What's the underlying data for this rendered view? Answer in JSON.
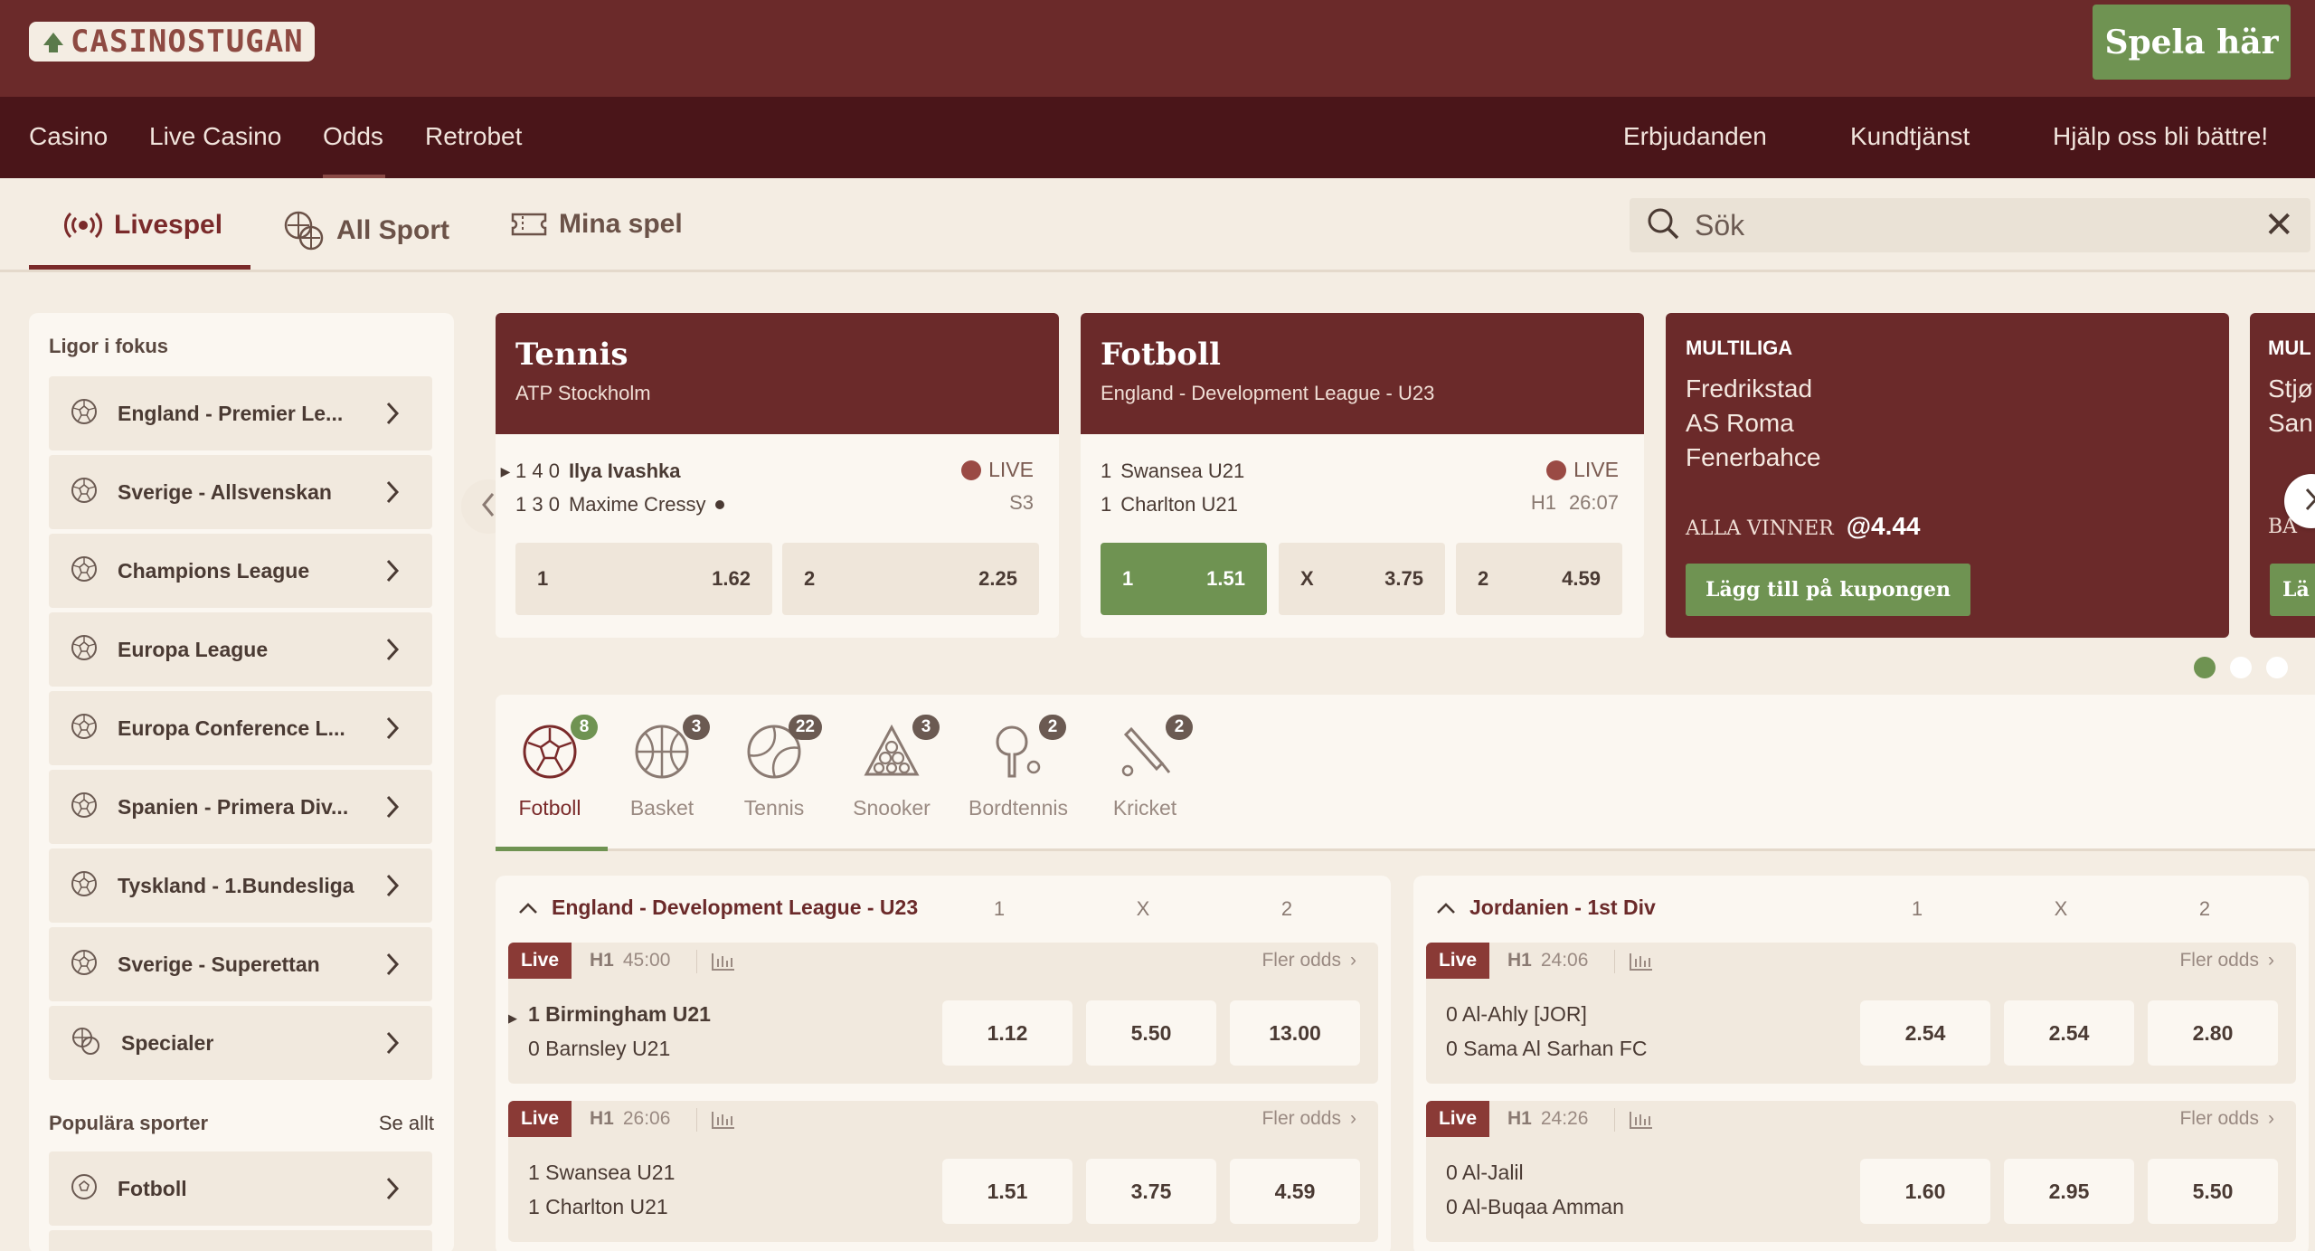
{
  "brand": {
    "name": "CASINOSTUGAN",
    "cta": "Spela här"
  },
  "nav": {
    "left": [
      "Casino",
      "Live Casino",
      "Odds",
      "Retrobet"
    ],
    "right": [
      "Erbjudanden",
      "Kundtjänst",
      "Hjälp oss bli bättre!"
    ],
    "active": "Odds"
  },
  "tabs": [
    {
      "label": "Livespel",
      "icon": "live-broadcast-icon",
      "active": true
    },
    {
      "label": "All Sport",
      "icon": "sports-balls-icon"
    },
    {
      "label": "Mina spel",
      "icon": "ticket-icon"
    }
  ],
  "search": {
    "placeholder": "Sök"
  },
  "sidebar": {
    "focus_title": "Ligor i fokus",
    "leagues": [
      "England - Premier Le...",
      "Sverige - Allsvenskan",
      "Champions League",
      "Europa League",
      "Europa Conference L...",
      "Spanien - Primera Div...",
      "Tyskland - 1.Bundesliga",
      "Sverige - Superettan",
      "Specialer"
    ],
    "popular_title": "Populära sporter",
    "see_all": "Se allt",
    "popular": [
      "Fotboll"
    ]
  },
  "cards": [
    {
      "sport": "Tennis",
      "league": "ATP Stockholm",
      "p1": {
        "score": "1 4 0",
        "name": "Ilya Ivashka"
      },
      "p2": {
        "score": "1 3 0",
        "name": "Maxime Cressy"
      },
      "status": "LIVE",
      "meta": "S3",
      "odds": [
        {
          "label": "1",
          "value": "1.62"
        },
        {
          "label": "2",
          "value": "2.25"
        }
      ]
    },
    {
      "sport": "Fotboll",
      "league": "England - Development League - U23",
      "p1": {
        "score": "1",
        "name": "Swansea U21"
      },
      "p2": {
        "score": "1",
        "name": "Charlton U21"
      },
      "status": "LIVE",
      "meta_period": "H1",
      "meta_time": "26:07",
      "odds": [
        {
          "label": "1",
          "value": "1.51",
          "selected": true
        },
        {
          "label": "X",
          "value": "3.75"
        },
        {
          "label": "2",
          "value": "4.59"
        }
      ]
    }
  ],
  "multi": {
    "title": "MULTILIGA",
    "teams": [
      "Fredrikstad",
      "AS Roma",
      "Fenerbahce"
    ],
    "win_label": "ALLA VINNER",
    "odds": "@4.44",
    "button": "Lägg till på kupongen",
    "next_title": "MUL",
    "next_teams": [
      "Stjø",
      "San"
    ],
    "next_win": "BA",
    "next_btn": "Lä"
  },
  "carousel": {
    "pages": 3,
    "current": 1
  },
  "sports": [
    {
      "label": "Fotboll",
      "count": "8",
      "icon": "football-icon",
      "active": true
    },
    {
      "label": "Basket",
      "count": "3",
      "icon": "basketball-icon"
    },
    {
      "label": "Tennis",
      "count": "22",
      "icon": "tennis-ball-icon"
    },
    {
      "label": "Snooker",
      "count": "3",
      "icon": "snooker-icon"
    },
    {
      "label": "Bordtennis",
      "count": "2",
      "icon": "table-tennis-icon"
    },
    {
      "label": "Kricket",
      "count": "2",
      "icon": "cricket-icon"
    }
  ],
  "leagues": [
    {
      "name": "England - Development League - U23",
      "cols": [
        "1",
        "X",
        "2"
      ],
      "matches": [
        {
          "live": "Live",
          "period": "H1",
          "time": "45:00",
          "more": "Fler odds",
          "home": "1 Birmingham U21",
          "away": "0 Barnsley U21",
          "odds": [
            "1.12",
            "5.50",
            "13.00"
          ]
        },
        {
          "live": "Live",
          "period": "H1",
          "time": "26:06",
          "more": "Fler odds",
          "home": "1 Swansea U21",
          "away": "1 Charlton U21",
          "odds": [
            "1.51",
            "3.75",
            "4.59"
          ]
        }
      ]
    },
    {
      "name": "Jordanien - 1st Div",
      "cols": [
        "1",
        "X",
        "2"
      ],
      "matches": [
        {
          "live": "Live",
          "period": "H1",
          "time": "24:06",
          "more": "Fler odds",
          "home": "0 Al-Ahly [JOR]",
          "away": "0 Sama Al Sarhan FC",
          "odds": [
            "2.54",
            "2.54",
            "2.80"
          ]
        },
        {
          "live": "Live",
          "period": "H1",
          "time": "24:26",
          "more": "Fler odds",
          "home": "0 Al-Jalil",
          "away": "0 Al-Buqaa Amman",
          "odds": [
            "1.60",
            "2.95",
            "5.50"
          ]
        }
      ]
    }
  ],
  "colors": {
    "header": "#6b2a2a",
    "nav": "#4a1519",
    "accent": "#6f9352",
    "background": "#f4ede3"
  }
}
